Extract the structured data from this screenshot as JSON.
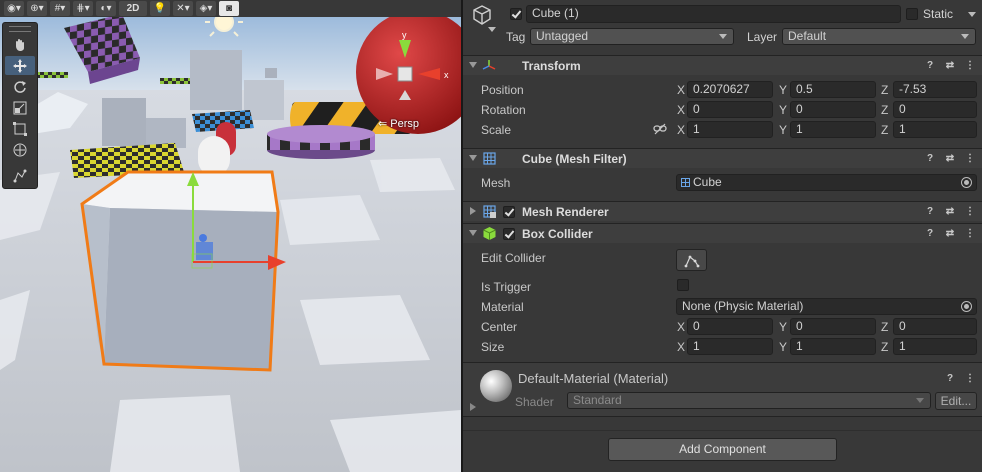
{
  "scene": {
    "toolbar": {
      "btn_2d": "2D"
    },
    "persp_label": "Persp",
    "tools": [
      {
        "name": "hand-tool-icon",
        "active": false
      },
      {
        "name": "move-tool-icon",
        "active": true
      },
      {
        "name": "rotate-tool-icon",
        "active": false
      },
      {
        "name": "scale-tool-icon",
        "active": false
      },
      {
        "name": "rect-tool-icon",
        "active": false
      },
      {
        "name": "transform-tool-icon",
        "active": false
      },
      {
        "name": "custom-tool-icon",
        "active": false
      }
    ]
  },
  "inspector": {
    "object": {
      "name": "Cube (1)",
      "active": true,
      "static_label": "Static",
      "tag_label": "Tag",
      "tag_value": "Untagged",
      "layer_label": "Layer",
      "layer_value": "Default"
    },
    "transform": {
      "title": "Transform",
      "position_label": "Position",
      "rotation_label": "Rotation",
      "scale_label": "Scale",
      "position": {
        "x": "0.2070627",
        "y": "0.5",
        "z": "-7.53"
      },
      "rotation": {
        "x": "0",
        "y": "0",
        "z": "0"
      },
      "scale": {
        "x": "1",
        "y": "1",
        "z": "1"
      }
    },
    "axes": {
      "x": "X",
      "y": "Y",
      "z": "Z"
    },
    "mesh_filter": {
      "title": "Cube (Mesh Filter)",
      "mesh_label": "Mesh",
      "mesh_value": "Cube"
    },
    "mesh_renderer": {
      "title": "Mesh Renderer",
      "enabled": true
    },
    "box_collider": {
      "title": "Box Collider",
      "enabled": true,
      "edit_label": "Edit Collider",
      "is_trigger_label": "Is Trigger",
      "material_label": "Material",
      "material_value": "None (Physic Material)",
      "center_label": "Center",
      "size_label": "Size",
      "center": {
        "x": "0",
        "y": "0",
        "z": "0"
      },
      "size": {
        "x": "1",
        "y": "1",
        "z": "1"
      }
    },
    "material": {
      "title": "Default-Material (Material)",
      "shader_label": "Shader",
      "shader_value": "Standard",
      "edit_button": "Edit..."
    },
    "add_component": "Add Component"
  },
  "colors": {
    "accent_blue": "#46607c",
    "selection_orange": "#f07b17",
    "inspector_bg": "#383838"
  }
}
